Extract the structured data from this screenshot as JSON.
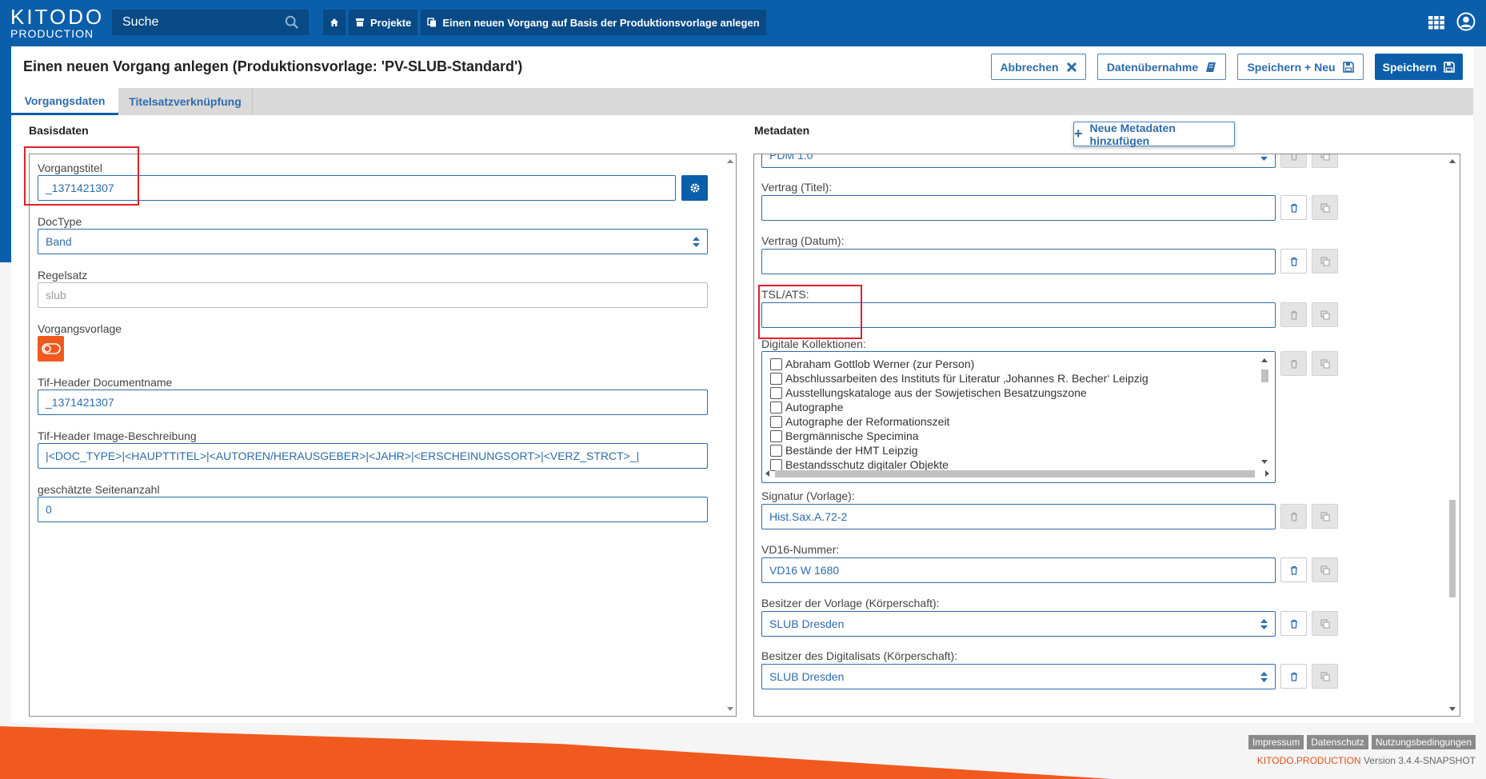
{
  "app": {
    "brand_name": "KITODO",
    "brand_sub": "PRODUCTION"
  },
  "search": {
    "placeholder": "Suche"
  },
  "breadcrumbs": [
    {
      "label": "",
      "icon": "home-icon"
    },
    {
      "label": "Projekte",
      "icon": "projects-icon"
    },
    {
      "label": "Einen neuen Vorgang auf Basis der Produktionsvorlage anlegen",
      "icon": "copy-icon"
    }
  ],
  "header": {
    "title": "Einen neuen Vorgang anlegen (Produktionsvorlage: 'PV-SLUB-Standard')",
    "cancel_label": "Abbrechen",
    "import_label": "Datenübernahme",
    "save_new_label": "Speichern + Neu",
    "save_label": "Speichern"
  },
  "tabs": [
    {
      "label": "Vorgangsdaten",
      "active": true
    },
    {
      "label": "Titelsatzverknüpfung",
      "active": false
    }
  ],
  "basisdaten": {
    "heading": "Basisdaten",
    "vorgangstitel_label": "Vorgangstitel",
    "vorgangstitel_value": "_1371421307",
    "doctype_label": "DocType",
    "doctype_value": "Band",
    "regelsatz_label": "Regelsatz",
    "regelsatz_value": "slub",
    "vorgangsvorlage_label": "Vorgangsvorlage",
    "tif_docname_label": "Tif-Header Documentname",
    "tif_docname_value": "_1371421307",
    "tif_imgdesc_label": "Tif-Header Image-Beschreibung",
    "tif_imgdesc_value": "|<DOC_TYPE>|<HAUPTTITEL>|<AUTOREN/HERAUSGEBER>|<JAHR>|<ERSCHEINUNGSORT>|<VERZ_STRCT>_|",
    "seitenanzahl_label": "geschätzte Seitenanzahl",
    "seitenanzahl_value": "0"
  },
  "metadaten": {
    "heading": "Metadaten",
    "add_button_label": "Neue Metadaten hinzufügen",
    "license_value": "PDM 1.0",
    "vertrag_titel_label": "Vertrag (Titel):",
    "vertrag_titel_value": "",
    "vertrag_datum_label": "Vertrag (Datum):",
    "vertrag_datum_value": "",
    "tsl_label": "TSL/ATS:",
    "tsl_value": "",
    "kollektionen_label": "Digitale Kollektionen:",
    "kollektionen": [
      "Abraham Gottlob Werner (zur Person)",
      "Abschlussarbeiten des Instituts für Literatur ‚Johannes R. Becher‘ Leipzig",
      "Ausstellungskataloge aus der Sowjetischen Besatzungszone",
      "Autographe",
      "Autographe der Reformationszeit",
      "Bergmännische Specimina",
      "Bestände der HMT Leipzig",
      "Bestandsschutz digitaler Objekte"
    ],
    "signatur_label": "Signatur (Vorlage):",
    "signatur_value": "Hist.Sax.A.72-2",
    "vd16_label": "VD16-Nummer:",
    "vd16_value": "VD16 W 1680",
    "besitzer_vorlage_label": "Besitzer der Vorlage (Körperschaft):",
    "besitzer_vorlage_value": "SLUB Dresden",
    "besitzer_digitalisat_label": "Besitzer des Digitalisats (Körperschaft):",
    "besitzer_digitalisat_value": "SLUB Dresden"
  },
  "footer": {
    "links": [
      "Impressum",
      "Datenschutz",
      "Nutzungsbedingungen"
    ],
    "brand": "KITODO.PRODUCTION",
    "version": "Version 3.4.4-SNAPSHOT"
  },
  "colors": {
    "primary_blue": "#0b5ea9",
    "accent_orange": "#f05a1f",
    "highlight_red": "#e0202a"
  }
}
